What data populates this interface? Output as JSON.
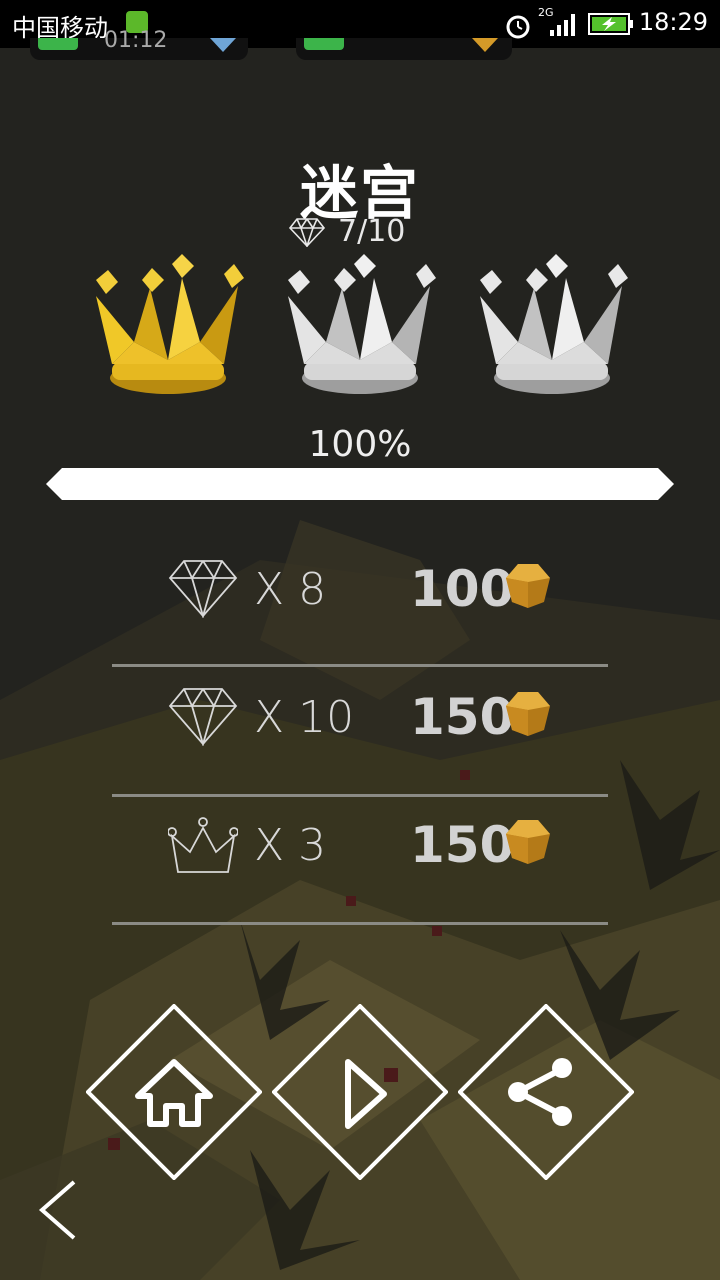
{
  "status_bar": {
    "carrier": "中国移动",
    "network": "2G",
    "time": "18:29"
  },
  "hud": {
    "timer": "01:12"
  },
  "level": {
    "title": "迷宫",
    "gems_collected": "7/10",
    "crowns_earned": 1,
    "crowns_total": 3,
    "progress_label": "100%",
    "progress": 1.0
  },
  "rewards": [
    {
      "icon": "diamond-icon",
      "multiplier": "X 8",
      "amount": "100"
    },
    {
      "icon": "diamond-icon",
      "multiplier": "X 10",
      "amount": "150"
    },
    {
      "icon": "crown-icon",
      "multiplier": "X 3",
      "amount": "150"
    }
  ],
  "buttons": [
    {
      "name": "home-button",
      "icon": "home-icon"
    },
    {
      "name": "play-button",
      "icon": "play-icon"
    },
    {
      "name": "share-button",
      "icon": "share-icon"
    }
  ],
  "colors": {
    "gold_crown": "#e8b820",
    "silver_crown": "#cfcfcf",
    "coin": "#d49a28",
    "bar": "#ffffff"
  }
}
